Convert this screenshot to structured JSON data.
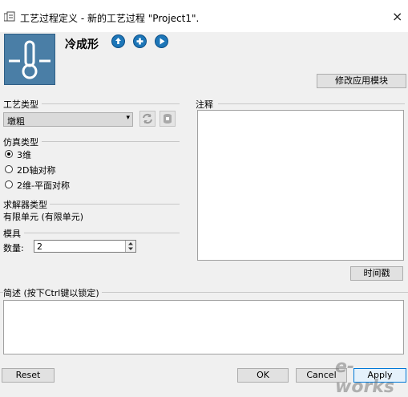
{
  "window": {
    "title": "工艺过程定义 - 新的工艺过程 \"Project1\".",
    "close_glyph": "×"
  },
  "header": {
    "process_name": "冷成形",
    "modify_module_button": "修改应用模块",
    "nav_icons": [
      "arrow-up-circle-icon",
      "plus-circle-icon",
      "play-circle-icon"
    ]
  },
  "process_type": {
    "label": "工艺类型",
    "selected": "墩粗",
    "dropdown_glyph": "▾"
  },
  "simulation_type": {
    "label": "仿真类型",
    "options": [
      {
        "label": "3维",
        "selected": true
      },
      {
        "label": "2D轴对称",
        "selected": false
      },
      {
        "label": "2维-平面对称",
        "selected": false
      }
    ]
  },
  "solver_type": {
    "label": "求解器类型",
    "value": "有限单元 (有限单元)"
  },
  "die": {
    "label": "模具",
    "count_label": "数量:",
    "count_value": "2"
  },
  "notes": {
    "label": "注释",
    "value": "",
    "timestamp_button": "时间戳"
  },
  "description": {
    "label": "简述 (按下Ctrl键以锁定)",
    "value": ""
  },
  "footer": {
    "reset": "Reset",
    "ok": "OK",
    "cancel": "Cancel",
    "apply": "Apply"
  },
  "watermark": "e-works",
  "colors": {
    "icon_bg": "#4a7ea6",
    "nav_button": "#1d76b8",
    "primary_border": "#0078d7"
  }
}
